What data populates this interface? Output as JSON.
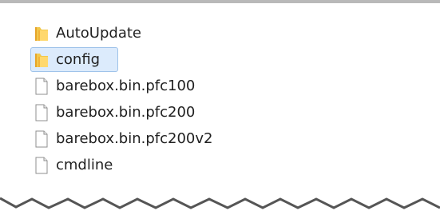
{
  "files": [
    {
      "name": "AutoUpdate",
      "icon": "folder-icon",
      "selected": false
    },
    {
      "name": "config",
      "icon": "folder-icon",
      "selected": true
    },
    {
      "name": "barebox.bin.pfc100",
      "icon": "file-icon",
      "selected": false
    },
    {
      "name": "barebox.bin.pfc200",
      "icon": "file-icon",
      "selected": false
    },
    {
      "name": "barebox.bin.pfc200v2",
      "icon": "file-icon",
      "selected": false
    },
    {
      "name": "cmdline",
      "icon": "file-icon",
      "selected": false
    }
  ],
  "colors": {
    "selection_fill": "#dcebfc",
    "selection_border": "#9fc3ea",
    "folder_yellow": "#f1c84c",
    "folder_orange": "#e6a42a"
  }
}
